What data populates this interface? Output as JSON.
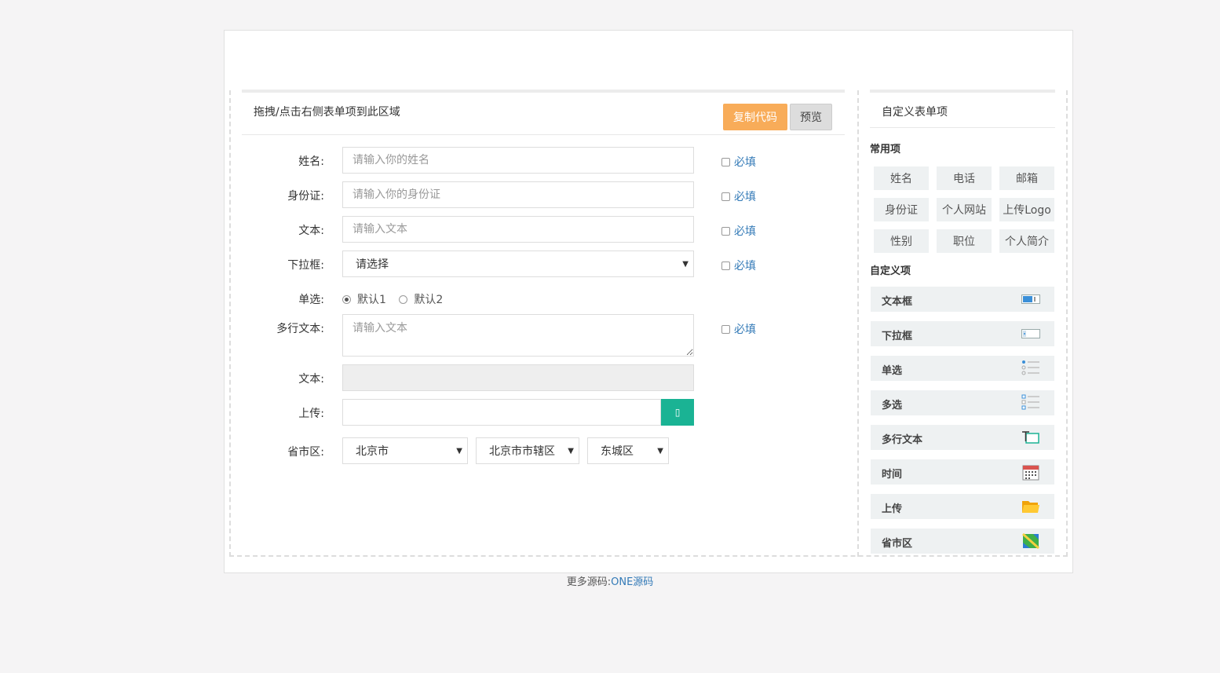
{
  "builder": {
    "drop_hint": "拖拽/点击右侧表单项到此区域",
    "copy_code": "复制代码",
    "preview": "预览"
  },
  "form": {
    "required_label": "必填",
    "name": {
      "label": "姓名:",
      "placeholder": "请输入你的姓名"
    },
    "id_card": {
      "label": "身份证:",
      "placeholder": "请输入你的身份证"
    },
    "text": {
      "label": "文本:",
      "placeholder": "请输入文本"
    },
    "dropdown": {
      "label": "下拉框:",
      "value": "请选择"
    },
    "radio": {
      "label": "单选:",
      "options": [
        "默认1",
        "默认2"
      ]
    },
    "textarea": {
      "label": "多行文本:",
      "placeholder": "请输入文本"
    },
    "text_disabled": {
      "label": "文本:"
    },
    "upload": {
      "label": "上传:",
      "button_icon": "upload-icon"
    },
    "region": {
      "label": "省市区:",
      "province": "北京市",
      "city": "北京市市辖区",
      "district": "东城区"
    }
  },
  "sidebar": {
    "title": "自定义表单项",
    "common_title": "常用项",
    "common_items": [
      "姓名",
      "电话",
      "邮箱",
      "身份证",
      "个人网站",
      "上传Logo",
      "性别",
      "职位",
      "个人简介"
    ],
    "custom_title": "自定义项",
    "custom_items": [
      {
        "label": "文本框",
        "icon": "textbox-icon"
      },
      {
        "label": "下拉框",
        "icon": "dropdown-icon"
      },
      {
        "label": "单选",
        "icon": "radio-list-icon"
      },
      {
        "label": "多选",
        "icon": "checkbox-list-icon"
      },
      {
        "label": "多行文本",
        "icon": "textarea-icon"
      },
      {
        "label": "时间",
        "icon": "calendar-icon"
      },
      {
        "label": "上传",
        "icon": "folder-icon"
      },
      {
        "label": "省市区",
        "icon": "map-icon"
      }
    ]
  },
  "footer": {
    "text": "更多源码:",
    "link": "ONE源码"
  },
  "colors": {
    "copy_button": "#f8ac59",
    "upload_button": "#1ab394",
    "link": "#337ab7"
  }
}
